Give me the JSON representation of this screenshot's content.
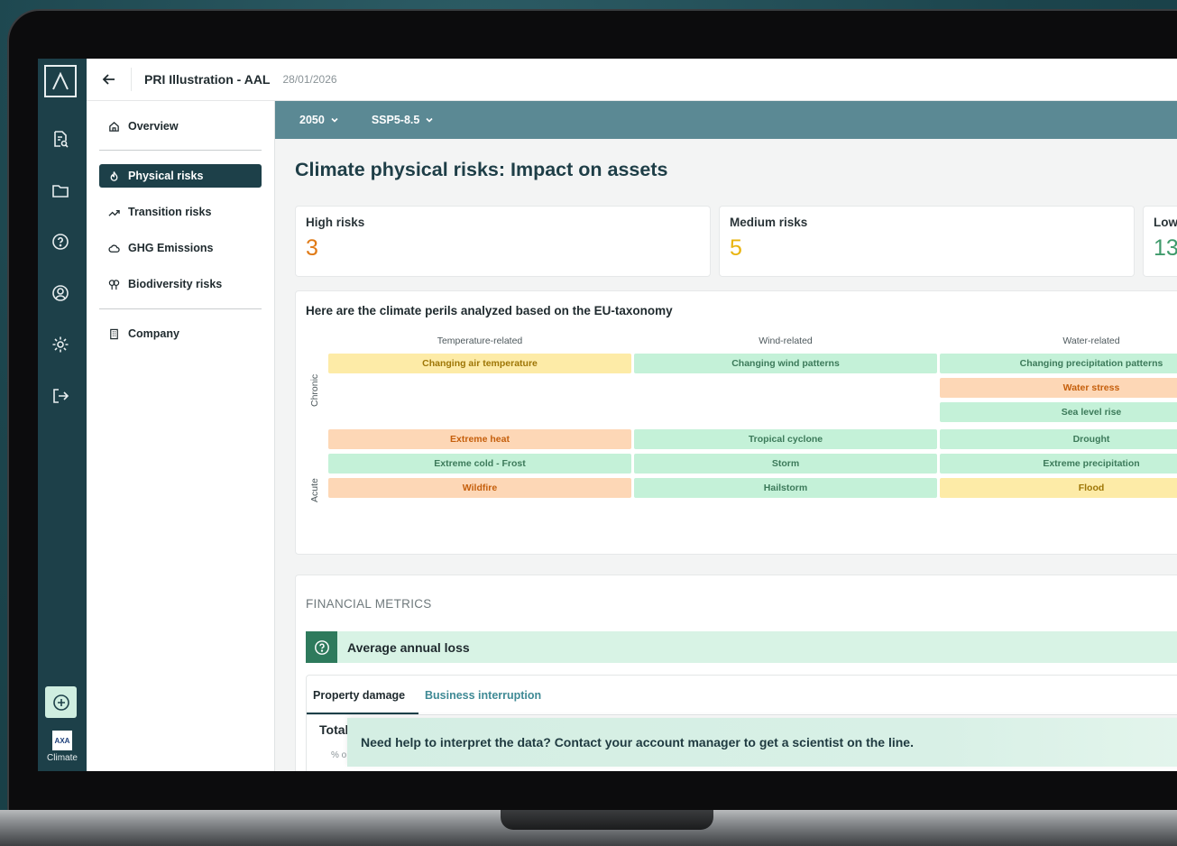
{
  "header": {
    "project_title": "PRI Illustration - AAL",
    "date": "28/01/2026"
  },
  "rail": {
    "icons": [
      "report-search-icon",
      "folder-icon",
      "help-circle-icon",
      "user-circle-icon",
      "settings-icon",
      "logout-icon"
    ],
    "add_icon": "plus-circle-icon",
    "brand_label": "Climate",
    "brand_logo_text": "AXA"
  },
  "sidenav": {
    "overview": "Overview",
    "physical_risks": "Physical risks",
    "transition_risks": "Transition risks",
    "ghg_emissions": "GHG Emissions",
    "biodiversity_risks": "Biodiversity risks",
    "company": "Company"
  },
  "filters": {
    "year": "2050",
    "scenario": "SSP5-8.5"
  },
  "main": {
    "title": "Climate physical risks: Impact on assets",
    "kpis": [
      {
        "label": "High risks",
        "value": "3",
        "color": "#e07a16"
      },
      {
        "label": "Medium risks",
        "value": "5",
        "color": "#e9b40f"
      },
      {
        "label": "Low",
        "value": "13",
        "color": "#3f9a6b"
      }
    ]
  },
  "perils": {
    "title": "Here are the climate perils analyzed based on the EU-taxonomy",
    "columns": [
      "Temperature-related",
      "Wind-related",
      "Water-related"
    ],
    "rows": {
      "chronic": "Chronic",
      "acute": "Acute"
    },
    "colors": {
      "high": "#fdd7b6",
      "medium": "#fdeba7",
      "low": "#c4f1d8",
      "high_text": "#c55f0c",
      "medium_text": "#9e7606",
      "low_text": "#3c7a5a"
    },
    "chronic": {
      "temperature": [
        {
          "label": "Changing air temperature",
          "level": "medium"
        }
      ],
      "wind": [
        {
          "label": "Changing wind patterns",
          "level": "low"
        }
      ],
      "water": [
        {
          "label": "Changing precipitation patterns",
          "level": "low"
        },
        {
          "label": "Water stress",
          "level": "high"
        },
        {
          "label": "Sea level rise",
          "level": "low"
        }
      ]
    },
    "acute": {
      "temperature": [
        {
          "label": "Extreme heat",
          "level": "high"
        },
        {
          "label": "Extreme cold - Frost",
          "level": "low"
        },
        {
          "label": "Wildfire",
          "level": "high"
        }
      ],
      "wind": [
        {
          "label": "Tropical cyclone",
          "level": "low"
        },
        {
          "label": "Storm",
          "level": "low"
        },
        {
          "label": "Hailstorm",
          "level": "low"
        }
      ],
      "water": [
        {
          "label": "Drought",
          "level": "low"
        },
        {
          "label": "Extreme precipitation",
          "level": "low"
        },
        {
          "label": "Flood",
          "level": "medium"
        }
      ]
    }
  },
  "financial": {
    "title": "FINANCIAL METRICS",
    "aal_label": "Average annual loss",
    "tabs": [
      "Property damage",
      "Business interruption"
    ],
    "total_label": "Total",
    "total_sub": "% o"
  },
  "help_banner": "Need help to interpret the data? Contact your account manager to get a scientist on the line."
}
